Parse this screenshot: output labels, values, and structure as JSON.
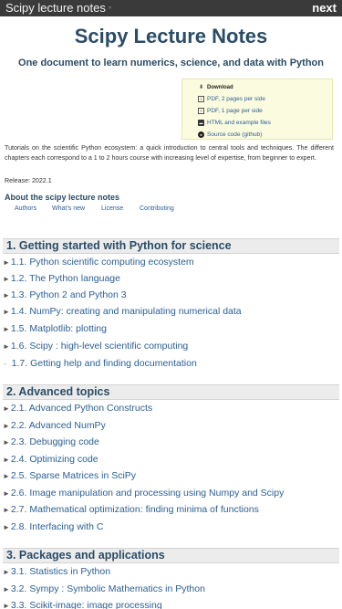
{
  "topbar": {
    "title": "Scipy lecture notes",
    "version": "»",
    "next_label": "next"
  },
  "header": {
    "title": "Scipy Lecture Notes",
    "subtitle": "One document to learn numerics, science, and data with Python"
  },
  "download": {
    "heading": "Download",
    "items": [
      {
        "label": "PDF, 2 pages per side",
        "icon": "file-icon"
      },
      {
        "label": "PDF, 1 page per side",
        "icon": "file-icon"
      },
      {
        "label": "HTML and example files",
        "icon": "archive-icon"
      },
      {
        "label": "Source code (github)",
        "icon": "github-icon"
      }
    ]
  },
  "intro": {
    "text": "Tutorials on the scientific Python ecosystem: a quick introduction to central tools and techniques. The different chapters each correspond to a 1 to 2 hours course with increasing level of expertise, from beginner to expert.",
    "release": "Release: 2022.1"
  },
  "about": {
    "title": "About the scipy lecture notes",
    "links": [
      "Authors",
      "What’s new",
      "License",
      "Contributing"
    ]
  },
  "sections": [
    {
      "title": "1. Getting started with Python for science",
      "items": [
        "1.1. Python scientific computing ecosystem",
        "1.2. The Python language",
        "1.3. Python 2 and Python 3",
        "1.4. NumPy: creating and manipulating numerical data",
        "1.5. Matplotlib: plotting",
        "1.6. Scipy : high-level scientific computing",
        "1.7. Getting help and finding documentation"
      ]
    },
    {
      "title": "2. Advanced topics",
      "items": [
        "2.1. Advanced Python Constructs",
        "2.2. Advanced NumPy",
        "2.3. Debugging code",
        "2.4. Optimizing code",
        "2.5. Sparse Matrices in SciPy",
        "2.6. Image manipulation and processing using Numpy and Scipy",
        "2.7. Mathematical optimization: finding minima of functions",
        "2.8. Interfacing with C"
      ]
    },
    {
      "title": "3. Packages and applications",
      "items": [
        "3.1. Statistics in Python",
        "3.2. Sympy : Symbolic Mathematics in Python",
        "3.3. Scikit-image: image processing"
      ]
    }
  ],
  "colors": {
    "topbar": "#3a3a3a",
    "heading": "#2b4c66",
    "link": "#2b5f93",
    "download_bg": "#fbfbdf"
  }
}
